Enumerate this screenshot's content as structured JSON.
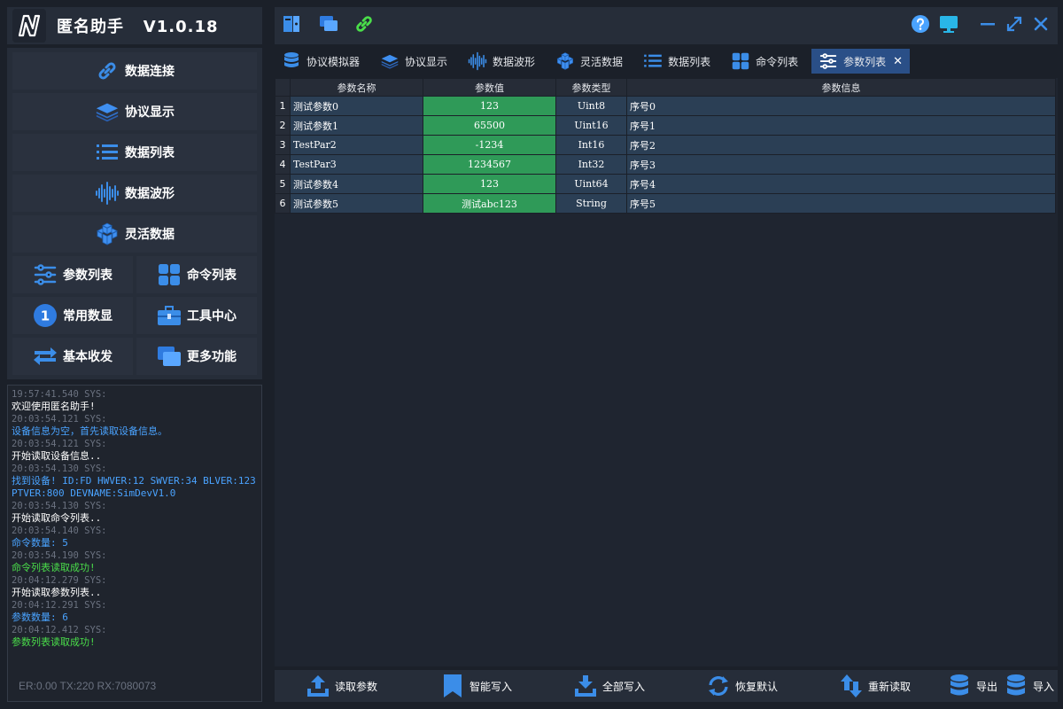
{
  "app": {
    "title": "匿名助手   V1.0.18"
  },
  "nav": {
    "data_connect": "数据连接",
    "protocol_display": "协议显示",
    "data_list": "数据列表",
    "data_waveform": "数据波形",
    "flexible_data": "灵活数据",
    "param_list": "参数列表",
    "command_list": "命令列表",
    "common_display": "常用数显",
    "tool_center": "工具中心",
    "basic_txrx": "基本收发",
    "more_functions": "更多功能",
    "common_display_badge": "1"
  },
  "log": {
    "entries": [
      {
        "time": "19:57:41.540 SYS:",
        "msg": "欢迎使用匿名助手!",
        "color": "#ffffff"
      },
      {
        "time": "20:03:54.121 SYS:",
        "msg": "设备信息为空，首先读取设备信息。",
        "color": "#4aa3ff"
      },
      {
        "time": "20:03:54.121 SYS:",
        "msg": "开始读取设备信息..",
        "color": "#ffffff"
      },
      {
        "time": "20:03:54.130 SYS:",
        "msg": "找到设备! ID:FD HWVER:12 SWVER:34 BLVER:123 PTVER:800 DEVNAME:SimDevV1.0",
        "color": "#4aa3ff"
      },
      {
        "time": "20:03:54.130 SYS:",
        "msg": "开始读取命令列表..",
        "color": "#ffffff"
      },
      {
        "time": "20:03:54.140 SYS:",
        "msg": "命令数量: 5",
        "color": "#4aa3ff"
      },
      {
        "time": "20:03:54.190 SYS:",
        "msg": "命令列表读取成功!",
        "color": "#4ade4a"
      },
      {
        "time": "20:04:12.279 SYS:",
        "msg": "开始读取参数列表..",
        "color": "#ffffff"
      },
      {
        "time": "20:04:12.291 SYS:",
        "msg": "参数数量: 6",
        "color": "#4aa3ff"
      },
      {
        "time": "20:04:12.412 SYS:",
        "msg": "参数列表读取成功!",
        "color": "#4ade4a"
      }
    ],
    "status": "ER:0.00 TX:220 RX:7080073"
  },
  "tabs": [
    {
      "label": "协议模拟器"
    },
    {
      "label": "协议显示"
    },
    {
      "label": "数据波形"
    },
    {
      "label": "灵活数据"
    },
    {
      "label": "数据列表"
    },
    {
      "label": "命令列表"
    },
    {
      "label": "参数列表"
    }
  ],
  "table": {
    "headers": {
      "name": "参数名称",
      "value": "参数值",
      "type": "参数类型",
      "info": "参数信息"
    },
    "rows": [
      {
        "num": "1",
        "name": "测试参数0",
        "value": "123",
        "type": "Uint8",
        "info": "序号0"
      },
      {
        "num": "2",
        "name": "测试参数1",
        "value": "65500",
        "type": "Uint16",
        "info": "序号1"
      },
      {
        "num": "3",
        "name": "TestPar2",
        "value": "-1234",
        "type": "Int16",
        "info": "序号2"
      },
      {
        "num": "4",
        "name": "TestPar3",
        "value": "1234567",
        "type": "Int32",
        "info": "序号3"
      },
      {
        "num": "5",
        "name": "测试参数4",
        "value": "123",
        "type": "Uint64",
        "info": "序号4"
      },
      {
        "num": "6",
        "name": "测试参数5",
        "value": "测试abc123",
        "type": "String",
        "info": "序号5"
      }
    ]
  },
  "bottom": {
    "read_params": "读取参数",
    "smart_write": "智能写入",
    "write_all": "全部写入",
    "restore_default": "恢复默认",
    "reread": "重新读取",
    "export": "导出",
    "import": "导入"
  },
  "colors": {
    "accent": "#2a4f87",
    "value_cell": "#2f9a58",
    "row_bg": "#2b3f55",
    "log_info": "#4aa3ff",
    "log_success": "#4ade4a"
  }
}
